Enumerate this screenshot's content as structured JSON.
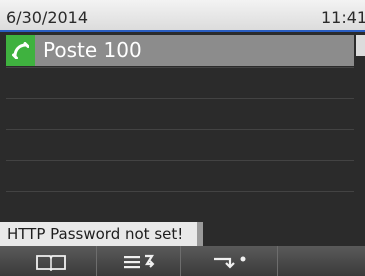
{
  "status_bar": {
    "date": "6/30/2014",
    "time": "11:41"
  },
  "line_keys": [
    {
      "label": "Poste 100",
      "icon": "handset-icon",
      "state": "selected"
    }
  ],
  "notification": {
    "text": "HTTP Password not set!"
  },
  "softkeys": [
    {
      "icon": "directory-book-icon"
    },
    {
      "icon": "menu-icon"
    },
    {
      "icon": "forward-icon"
    },
    {
      "icon": ""
    }
  ],
  "colors": {
    "accent": "#2a5ec2",
    "line_icon": "#3fb23f",
    "selected_row": "#8c8c8c",
    "background": "#2b2b2b"
  }
}
